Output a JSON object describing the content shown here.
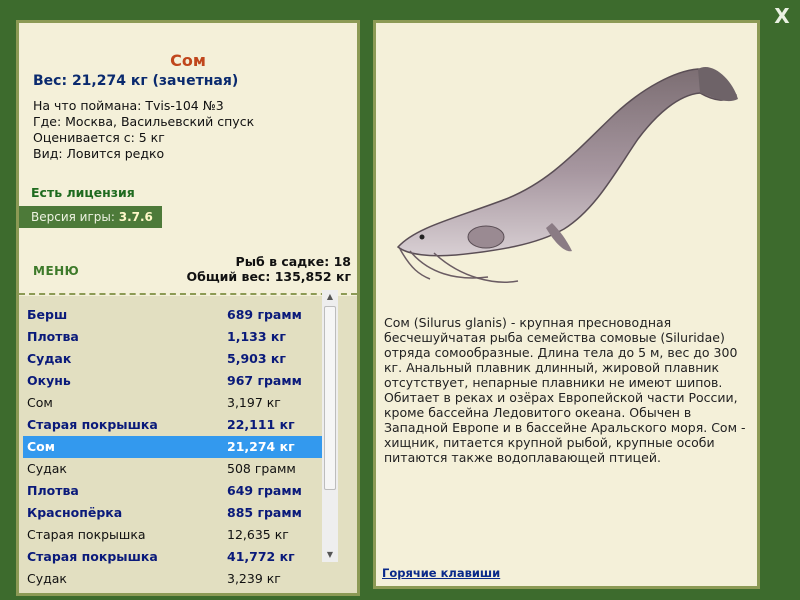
{
  "window": {
    "close_label": "X"
  },
  "fish": {
    "name": "Сом",
    "weight_line": "Вес: 21,274 кг (зачетная)",
    "caught_on": "На что поймана: Tvis-104 №3",
    "location": "Где: Москва, Васильевский спуск",
    "valued_from": "Оценивается с: 5 кг",
    "rarity": "Вид: Ловится редко"
  },
  "license": "Есть лицензия",
  "version": {
    "label": "Версия игры:",
    "value": "3.7.6"
  },
  "menu_label": "МЕНЮ",
  "cage": {
    "count_line": "Рыб в садке: 18",
    "total_line": "Общий вес: 135,852 кг"
  },
  "catch_list": [
    {
      "name": "Берш",
      "weight": "689 грамм",
      "bold": true
    },
    {
      "name": "Плотва",
      "weight": "1,133 кг",
      "bold": true
    },
    {
      "name": "Судак",
      "weight": "5,903 кг",
      "bold": true
    },
    {
      "name": "Окунь",
      "weight": "967 грамм",
      "bold": true
    },
    {
      "name": "Сом",
      "weight": "3,197 кг",
      "bold": false
    },
    {
      "name": "Старая покрышка",
      "weight": "22,111 кг",
      "bold": true
    },
    {
      "name": "Сом",
      "weight": "21,274 кг",
      "bold": true,
      "selected": true
    },
    {
      "name": "Судак",
      "weight": "508 грамм",
      "bold": false
    },
    {
      "name": "Плотва",
      "weight": "649 грамм",
      "bold": true
    },
    {
      "name": "Краснопёрка",
      "weight": "885 грамм",
      "bold": true
    },
    {
      "name": "Старая покрышка",
      "weight": "12,635 кг",
      "bold": false
    },
    {
      "name": "Старая покрышка",
      "weight": "41,772 кг",
      "bold": true
    },
    {
      "name": "Судак",
      "weight": "3,239 кг",
      "bold": false
    }
  ],
  "description": "Сом (Silurus glanis) - крупная пресноводная бесчешуйчатая рыба семейства сомовые (Siluridae) отряда сомообразные. Длина тела до 5 м, вес до 300 кг. Анальный плавник длинный, жировой плавник отсутствует, непарные плавники не имеют шипов. Обитает в реках и озёрах Европейской части России, кроме бассейна Ледовитого океана. Обычен в Западной Европе и в бассейне Аральского моря. Сом - хищник, питается крупной рыбой, крупные особи питаются также водоплавающей птицей.",
  "hotkeys_label": "Горячие клавиши",
  "colors": {
    "background": "#3d6b2d",
    "panel": "#f4f0d9",
    "selected": "#3399ee",
    "accent": "#c0461c"
  }
}
